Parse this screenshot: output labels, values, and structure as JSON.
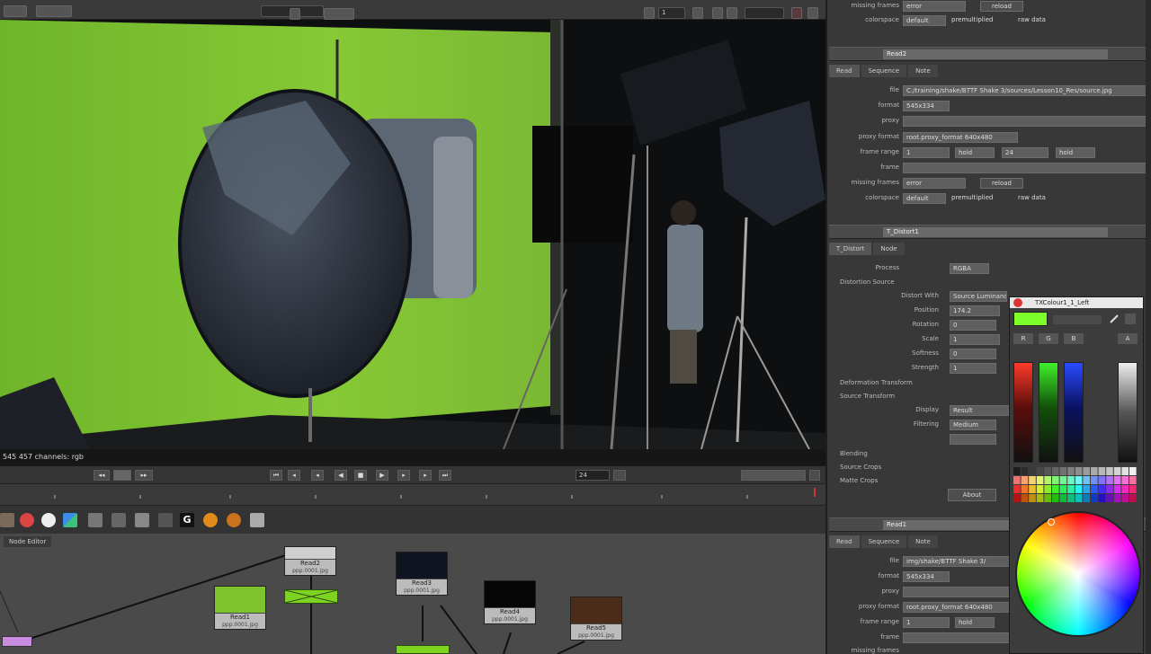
{
  "viewer": {
    "status": "545 457 channels: rgb",
    "zoom_value": "1"
  },
  "transport": {
    "frame": "24"
  },
  "node_graph": {
    "tab_label": "Node Editor",
    "nodes": [
      {
        "label": "Read2",
        "sub": "ppp.0001.jpg"
      },
      {
        "label": "Read1",
        "sub": "ppp.0001.jpg"
      },
      {
        "label": "Read3",
        "sub": "ppp.0001.jpg"
      },
      {
        "label": "Read4",
        "sub": "ppp.0001.jpg"
      },
      {
        "label": "Read5",
        "sub": "ppp.0001.jpg"
      }
    ]
  },
  "props": {
    "top": {
      "missing_frames_label": "missing frames",
      "missing_frames_value": "error",
      "colorspace_label": "colorspace",
      "colorspace_value": "default",
      "premultiplied": "premultiplied",
      "raw_data": "raw data",
      "reload": "reload"
    },
    "read1": {
      "name": "Read2",
      "tabs": [
        "Read",
        "Sequence",
        "Note"
      ],
      "file_label": "file",
      "file_value": "C:/training/shake/BTTF Shake 3/sources/Lesson10_Res/source.jpg",
      "format_label": "format",
      "format_value": "545x334",
      "proxy_label": "proxy",
      "proxy_format_label": "proxy format",
      "proxy_format_value": "root.proxy_format 640x480",
      "frame_range_label": "frame range",
      "frame_range_start": "1",
      "frame_range_mode": "hold",
      "frame_range_end": "24",
      "frame_range_after": "hold",
      "frame_label": "frame",
      "missing_frames_label": "missing frames",
      "missing_frames_value": "error",
      "reload": "reload",
      "colorspace_label": "colorspace",
      "colorspace_value": "default",
      "premultiplied": "premultiplied",
      "raw_data": "raw data"
    },
    "distort": {
      "name": "T_Distort1",
      "tabs": [
        "T_Distort",
        "Node"
      ],
      "process_label": "Process",
      "process_value": "RGBA",
      "distortion_source": "Distortion Source",
      "distort_with_label": "Distort With",
      "distort_with_value": "Source Luminance",
      "position_label": "Position",
      "position_value": "174.2",
      "rotation_label": "Rotation",
      "rotation_value": "0",
      "scale_label": "Scale",
      "scale_value": "1",
      "softness_label": "Softness",
      "softness_value": "0",
      "strength_label": "Strength",
      "strength_value": "1",
      "deformation_transform": "Deformation Transform",
      "source_transform": "Source Transform",
      "display_label": "Display",
      "display_value": "Result",
      "filtering_label": "Filtering",
      "filtering_value": "Medium",
      "blending": "Blending",
      "source_crops": "Source Crops",
      "matte_crops": "Matte Crops",
      "about": "About"
    },
    "read2": {
      "name": "Read1",
      "tabs": [
        "Read",
        "Sequence",
        "Note"
      ],
      "file_label": "file",
      "file_value": "img/shake/BTTF Shake 3/",
      "format_label": "format",
      "format_value": "545x334",
      "proxy_label": "proxy",
      "proxy_format_label": "proxy format",
      "proxy_format_value": "root.proxy_format 640x480",
      "frame_range_label": "frame range",
      "frame_range_start": "1",
      "frame_range_mode": "hold",
      "frame_label": "frame",
      "missing_frames_label": "missing frames"
    }
  },
  "picker": {
    "title": "TXColour1_1_Left",
    "swatch_color": "#7dff2a",
    "labels": [
      "R",
      "G",
      "B",
      "A"
    ]
  },
  "colors": {
    "greenscreen": "#7ec22e",
    "panel_bg": "#383838",
    "node_green": "#7ed321"
  }
}
